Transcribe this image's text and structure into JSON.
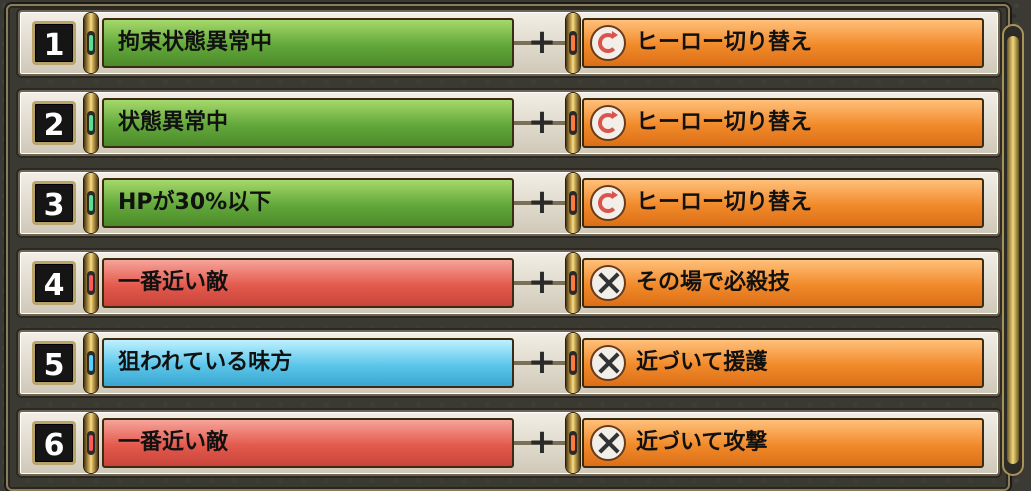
{
  "rows": [
    {
      "number": "1",
      "condition": "拘束状態異常中",
      "condition_color": "green",
      "action": "ヒーロー切り替え",
      "action_icon": "swap-icon"
    },
    {
      "number": "2",
      "condition": "状態異常中",
      "condition_color": "green",
      "action": "ヒーロー切り替え",
      "action_icon": "swap-icon"
    },
    {
      "number": "3",
      "condition": "HPが30%以下",
      "condition_color": "green",
      "action": "ヒーロー切り替え",
      "action_icon": "swap-icon"
    },
    {
      "number": "4",
      "condition": "一番近い敵",
      "condition_color": "red",
      "action": "その場で必殺技",
      "action_icon": "crossed-swords-icon"
    },
    {
      "number": "5",
      "condition": "狙われている味方",
      "condition_color": "cyan",
      "action": "近づいて援護",
      "action_icon": "crossed-swords-icon"
    },
    {
      "number": "6",
      "condition": "一番近い敵",
      "condition_color": "red",
      "action": "近づいて攻撃",
      "action_icon": "crossed-swords-icon"
    }
  ],
  "plus_symbol": "+",
  "colors": {
    "green": "#62a83a",
    "red": "#e45a4d",
    "cyan": "#5cc6ea",
    "orange": "#f18a2a",
    "gold": "#d7b55a"
  }
}
